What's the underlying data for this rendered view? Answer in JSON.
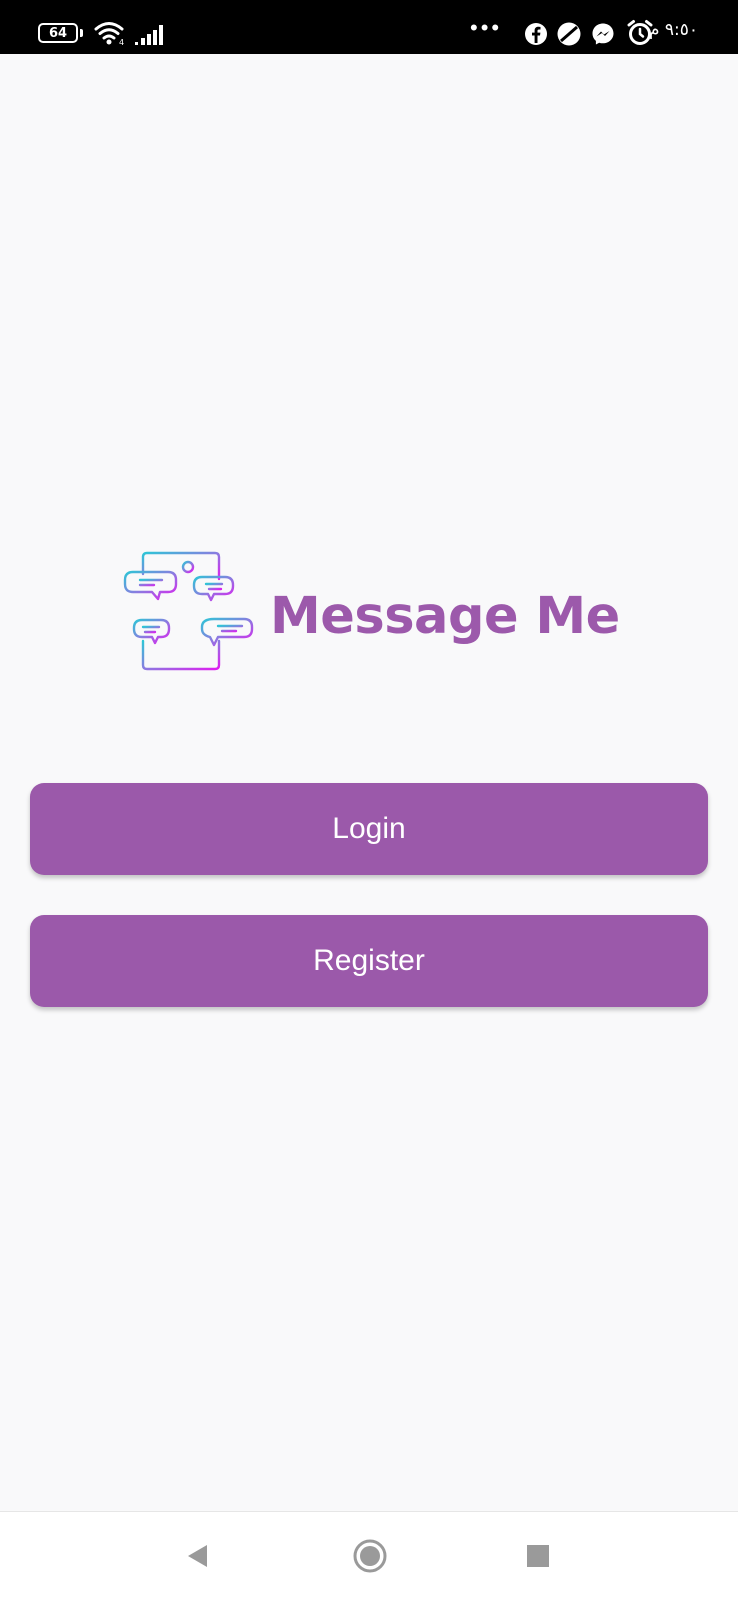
{
  "status_bar": {
    "battery_level": "64",
    "time": "٩:٥٠ م",
    "icons": [
      "battery-icon",
      "wifi-icon",
      "signal-icon",
      "more-dots-icon",
      "facebook-icon",
      "data-saver-icon",
      "messenger-icon",
      "alarm-icon"
    ]
  },
  "app": {
    "title": "Message Me",
    "brand_color": "#9c59ab",
    "logo_icon": "chat-phone-logo-icon"
  },
  "buttons": {
    "login_label": "Login",
    "register_label": "Register"
  },
  "nav_bar": {
    "icons": [
      "back-icon",
      "home-icon",
      "recents-icon"
    ]
  }
}
